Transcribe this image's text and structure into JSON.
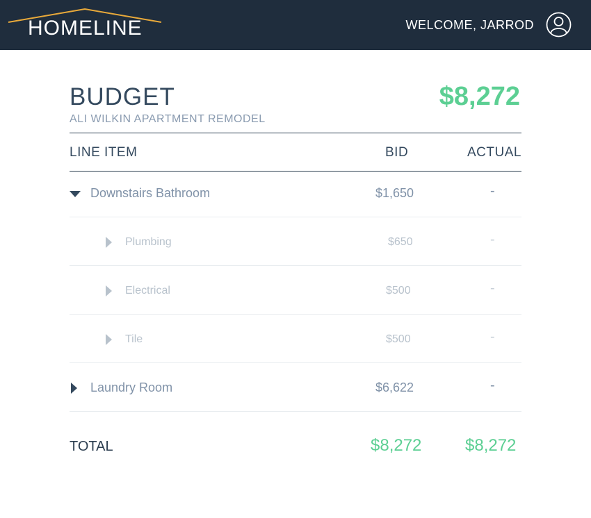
{
  "header": {
    "logo_text": "HOMELINE",
    "welcome": "WELCOME, JARROD",
    "user_icon": "user-circle-icon"
  },
  "budget": {
    "title": "BUDGET",
    "project": "ALI WILKIN APARTMENT REMODEL",
    "total": "$8,272"
  },
  "table": {
    "columns": [
      "LINE ITEM",
      "BID",
      "ACTUAL"
    ],
    "rows": [
      {
        "label": "Downstairs Bathroom",
        "bid": "$1,650",
        "actual": "-",
        "expanded": true
      },
      {
        "label": "Plumbing",
        "bid": "$650",
        "actual": "-",
        "sub": true
      },
      {
        "label": "Electrical",
        "bid": "$500",
        "actual": "-",
        "sub": true
      },
      {
        "label": "Tile",
        "bid": "$500",
        "actual": "-",
        "sub": true
      },
      {
        "label": "Laundry Room",
        "bid": "$6,622",
        "actual": "-",
        "expanded": false
      }
    ],
    "total": {
      "label": "TOTAL",
      "bid": "$8,272",
      "actual": "$8,272"
    }
  },
  "colors": {
    "topbar": "#1f2d3d",
    "accent_green": "#5ccf93",
    "logo_roof": "#e8a93a"
  }
}
